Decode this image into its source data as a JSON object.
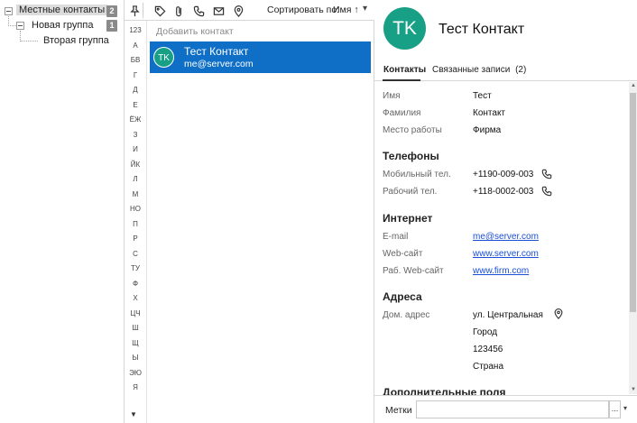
{
  "tree": {
    "items": [
      {
        "label": "Местные контакты",
        "count": "2"
      },
      {
        "label": "Новая группа",
        "count": "1"
      },
      {
        "label": "Вторая группа"
      }
    ]
  },
  "toolbar": {
    "icons": [
      "pin-icon",
      "tag-icon",
      "paperclip-icon",
      "phone-icon",
      "envelope-icon",
      "location-pin-icon"
    ],
    "sort_label": "Сортировать по:",
    "sort_value": "Имя",
    "sort_direction": "↑",
    "dropdown_glyph": "▾"
  },
  "alphabet": [
    "123",
    "А",
    "БВ",
    "Г",
    "Д",
    "Е",
    "ЁЖ",
    "З",
    "И",
    "ЙК",
    "Л",
    "М",
    "НО",
    "П",
    "Р",
    "С",
    "ТУ",
    "Ф",
    "Х",
    "ЦЧ",
    "Ш",
    "Щ",
    "Ы",
    "ЭЮ",
    "Я"
  ],
  "alphabet_scroll_down": "▼",
  "list": {
    "add_placeholder": "Добавить контакт",
    "contacts": [
      {
        "initials": "TK",
        "name": "Тест Контакт",
        "email": "me@server.com"
      }
    ]
  },
  "detail": {
    "initials": "TK",
    "name": "Тест Контакт",
    "tabs": [
      {
        "label": "Контакты"
      },
      {
        "label": "Связанные записи",
        "count": "(2)"
      }
    ],
    "fields": {
      "first_name": {
        "label": "Имя",
        "value": "Тест"
      },
      "last_name": {
        "label": "Фамилия",
        "value": "Контакт"
      },
      "company": {
        "label": "Место работы",
        "value": "Фирма"
      }
    },
    "phones": {
      "title": "Телефоны",
      "mobile": {
        "label": "Мобильный тел.",
        "value": "+1190-009-003"
      },
      "work": {
        "label": "Рабочий тел.",
        "value": "+118-0002-003"
      }
    },
    "internet": {
      "title": "Интернет",
      "email": {
        "label": "E-mail",
        "value": "me@server.com"
      },
      "website": {
        "label": "Web-сайт",
        "value": "www.server.com"
      },
      "work_website": {
        "label": "Раб. Web-сайт",
        "value": "www.firm.com"
      }
    },
    "addresses": {
      "title": "Адреса",
      "home": {
        "label": "Дом. адрес",
        "street": "ул. Центральная",
        "city": "Город",
        "zip": "123456",
        "country": "Страна"
      }
    },
    "extra_title": "Дополнительные поля",
    "scroll_up": "▲",
    "scroll_down": "▼"
  },
  "tags": {
    "label": "Метки",
    "more_button": "...",
    "dropdown_glyph": "▾"
  },
  "colors": {
    "selection": "#0f6fc6",
    "avatar": "#17a085",
    "link": "#1a4fd6"
  }
}
